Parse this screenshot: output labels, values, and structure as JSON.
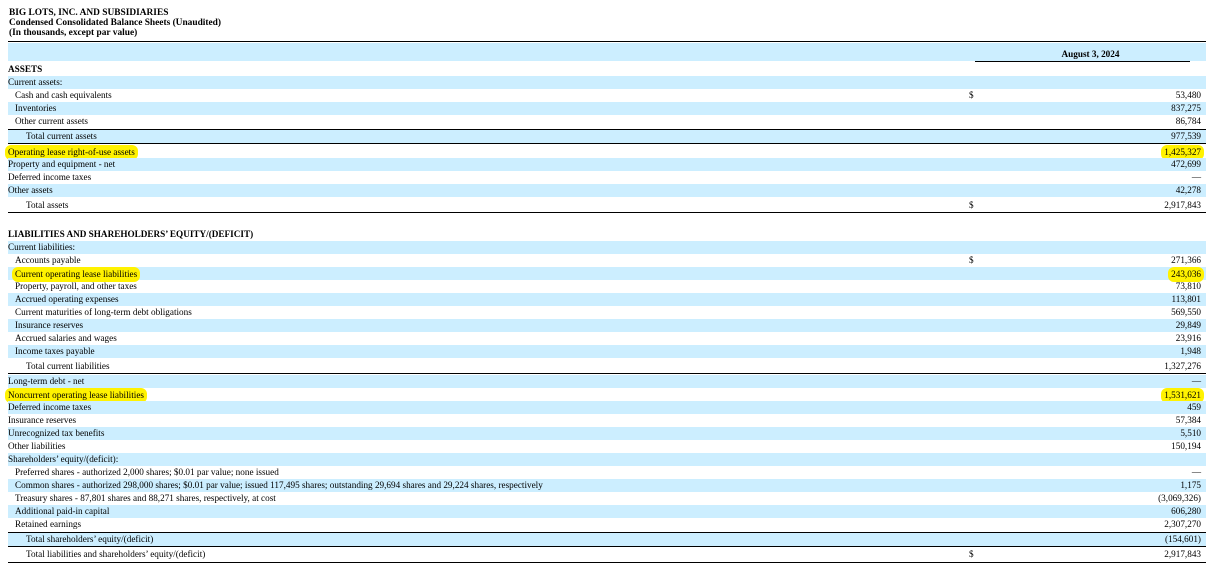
{
  "header": {
    "company": "BIG LOTS, INC. AND SUBSIDIARIES",
    "statement": "Condensed Consolidated Balance Sheets (Unaudited)",
    "units": "(In thousands, except par value)"
  },
  "column_header": "August 3, 2024",
  "currency_symbol": "$",
  "rows": [
    {
      "label": "ASSETS",
      "value": "",
      "indent": 0,
      "bold": true,
      "shade": false
    },
    {
      "label": "Current assets:",
      "value": "",
      "indent": 0,
      "bold": false,
      "shade": true
    },
    {
      "label": "Cash and cash equivalents",
      "value": "53,480",
      "indent": 1,
      "bold": false,
      "shade": false,
      "dollar": true
    },
    {
      "label": "Inventories",
      "value": "837,275",
      "indent": 1,
      "bold": false,
      "shade": true
    },
    {
      "label": "Other current assets",
      "value": "86,784",
      "indent": 1,
      "bold": false,
      "shade": false
    },
    {
      "label": "Total current assets",
      "value": "977,539",
      "indent": 2,
      "bold": false,
      "shade": true
    },
    {
      "label": "Operating lease right-of-use assets",
      "value": "1,425,327",
      "indent": 0,
      "bold": false,
      "shade": false,
      "highlight": true
    },
    {
      "label": "Property and equipment - net",
      "value": "472,699",
      "indent": 0,
      "bold": false,
      "shade": true
    },
    {
      "label": "Deferred income taxes",
      "value": "—",
      "indent": 0,
      "bold": false,
      "shade": false
    },
    {
      "label": "Other assets",
      "value": "42,278",
      "indent": 0,
      "bold": false,
      "shade": true
    },
    {
      "label": "Total assets",
      "value": "2,917,843",
      "indent": 2,
      "bold": false,
      "shade": false,
      "dollar": true
    },
    {
      "label": "LIABILITIES AND SHAREHOLDERS’ EQUITY/(DEFICIT)",
      "value": "",
      "indent": 0,
      "bold": true,
      "shade": false
    },
    {
      "label": "Current liabilities:",
      "value": "",
      "indent": 0,
      "bold": false,
      "shade": true
    },
    {
      "label": "Accounts payable",
      "value": "271,366",
      "indent": 1,
      "bold": false,
      "shade": false,
      "dollar": true
    },
    {
      "label": "Current operating lease liabilities",
      "value": "243,036",
      "indent": 1,
      "bold": false,
      "shade": true,
      "highlight": true
    },
    {
      "label": "Property, payroll, and other taxes",
      "value": "73,810",
      "indent": 1,
      "bold": false,
      "shade": false
    },
    {
      "label": "Accrued operating expenses",
      "value": "113,801",
      "indent": 1,
      "bold": false,
      "shade": true
    },
    {
      "label": "Current maturities of long-term debt obligations",
      "value": "569,550",
      "indent": 1,
      "bold": false,
      "shade": false
    },
    {
      "label": "Insurance reserves",
      "value": "29,849",
      "indent": 1,
      "bold": false,
      "shade": true
    },
    {
      "label": "Accrued salaries and wages",
      "value": "23,916",
      "indent": 1,
      "bold": false,
      "shade": false
    },
    {
      "label": "Income taxes payable",
      "value": "1,948",
      "indent": 1,
      "bold": false,
      "shade": true
    },
    {
      "label": "Total current liabilities",
      "value": "1,327,276",
      "indent": 2,
      "bold": false,
      "shade": false
    },
    {
      "label": "Long-term debt - net",
      "value": "—",
      "indent": 0,
      "bold": false,
      "shade": true
    },
    {
      "label": "Noncurrent operating lease liabilities",
      "value": "1,531,621",
      "indent": 0,
      "bold": false,
      "shade": false,
      "highlight": true
    },
    {
      "label": "Deferred income taxes",
      "value": "459",
      "indent": 0,
      "bold": false,
      "shade": true
    },
    {
      "label": "Insurance reserves",
      "value": "57,384",
      "indent": 0,
      "bold": false,
      "shade": false
    },
    {
      "label": "Unrecognized tax benefits",
      "value": "5,510",
      "indent": 0,
      "bold": false,
      "shade": true
    },
    {
      "label": "Other liabilities",
      "value": "150,194",
      "indent": 0,
      "bold": false,
      "shade": false
    },
    {
      "label": "Shareholders’ equity/(deficit):",
      "value": "",
      "indent": 0,
      "bold": false,
      "shade": true
    },
    {
      "label": "Preferred shares - authorized 2,000 shares; $0.01 par value; none issued",
      "value": "—",
      "indent": 1,
      "bold": false,
      "shade": false
    },
    {
      "label": "Common shares - authorized 298,000 shares; $0.01 par value; issued 117,495 shares; outstanding 29,694 shares and 29,224 shares, respectively",
      "value": "1,175",
      "indent": 1,
      "bold": false,
      "shade": true
    },
    {
      "label": "Treasury shares - 87,801 shares and 88,271 shares, respectively, at cost",
      "value": "(3,069,326)",
      "indent": 1,
      "bold": false,
      "shade": false
    },
    {
      "label": "Additional paid-in capital",
      "value": "606,280",
      "indent": 1,
      "bold": false,
      "shade": true
    },
    {
      "label": "Retained earnings",
      "value": "2,307,270",
      "indent": 1,
      "bold": false,
      "shade": false
    },
    {
      "label": "Total shareholders’ equity/(deficit)",
      "value": "(154,601)",
      "indent": 2,
      "bold": false,
      "shade": true
    },
    {
      "label": "Total liabilities and shareholders’ equity/(deficit)",
      "value": "2,917,843",
      "indent": 2,
      "bold": false,
      "shade": false,
      "dollar": true
    }
  ],
  "colors": {
    "row_shade": "#cceeff",
    "highlight": "#fff200",
    "text": "#000000"
  }
}
